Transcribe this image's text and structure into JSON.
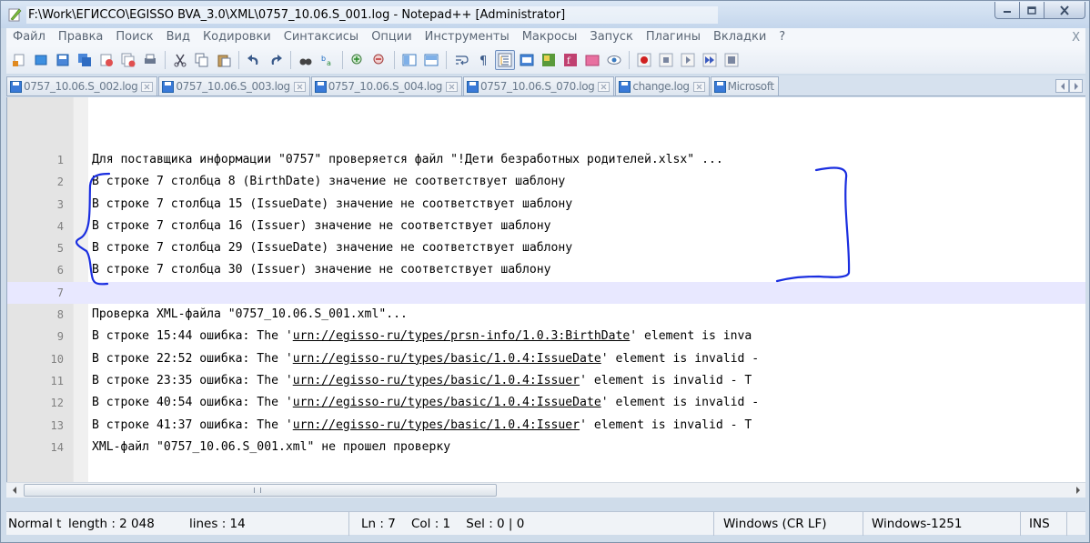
{
  "window": {
    "title": "F:\\Work\\ЕГИССО\\EGISSO BVA_3.0\\XML\\0757_10.06.S_001.log - Notepad++ [Administrator]"
  },
  "menu": {
    "items": [
      "Файл",
      "Правка",
      "Поиск",
      "Вид",
      "Кодировки",
      "Синтаксисы",
      "Опции",
      "Инструменты",
      "Макросы",
      "Запуск",
      "Плагины",
      "Вкладки",
      "?"
    ],
    "close": "X"
  },
  "tabs": [
    {
      "label": "0757_10.06.S_002.log"
    },
    {
      "label": "0757_10.06.S_003.log"
    },
    {
      "label": "0757_10.06.S_004.log"
    },
    {
      "label": "0757_10.06.S_070.log"
    },
    {
      "label": "change.log"
    },
    {
      "label": "Microsoft"
    }
  ],
  "editor": {
    "current_line": 7,
    "lines": [
      {
        "num": "1",
        "text": "Для поставщика информации \"0757\" проверяется файл \"!Дети безработных родителей.xlsx\" ..."
      },
      {
        "num": "2",
        "text": "В строке 7 столбца 8 (BirthDate) значение не соответствует шаблону"
      },
      {
        "num": "3",
        "text": "В строке 7 столбца 15 (IssueDate) значение не соответствует шаблону"
      },
      {
        "num": "4",
        "text": "В строке 7 столбца 16 (Issuer) значение не соответствует шаблону"
      },
      {
        "num": "5",
        "text": "В строке 7 столбца 29 (IssueDate) значение не соответствует шаблону"
      },
      {
        "num": "6",
        "text": "В строке 7 столбца 30 (Issuer) значение не соответствует шаблону"
      },
      {
        "num": "7",
        "text": ""
      },
      {
        "num": "8",
        "text": "Проверка XML-файла \"0757_10.06.S_001.xml\"..."
      },
      {
        "num": "9",
        "pre": "В строке 15:44 ошибка: The '",
        "url": "urn://egisso-ru/types/prsn-info/1.0.3:BirthDate",
        "post": "' element is inva"
      },
      {
        "num": "10",
        "pre": "В строке 22:52 ошибка: The '",
        "url": "urn://egisso-ru/types/basic/1.0.4:IssueDate",
        "post": "' element is invalid -"
      },
      {
        "num": "11",
        "pre": "В строке 23:35 ошибка: The '",
        "url": "urn://egisso-ru/types/basic/1.0.4:Issuer",
        "post": "' element is invalid - T"
      },
      {
        "num": "12",
        "pre": "В строке 40:54 ошибка: The '",
        "url": "urn://egisso-ru/types/basic/1.0.4:IssueDate",
        "post": "' element is invalid -"
      },
      {
        "num": "13",
        "pre": "В строке 41:37 ошибка: The '",
        "url": "urn://egisso-ru/types/basic/1.0.4:Issuer",
        "post": "' element is invalid - T"
      },
      {
        "num": "14",
        "text": "XML-файл \"0757_10.06.S_001.xml\" не прошел проверку"
      }
    ]
  },
  "status": {
    "mode": "Normal t",
    "length": "length : 2 048",
    "lines": "lines : 14",
    "position": "Ln : 7    Col : 1    Sel : 0 | 0",
    "eol": "Windows (CR LF)",
    "encoding": "Windows-1251",
    "ins": "INS"
  },
  "colors": {
    "annotation": "#1a2ee0",
    "current_line": "#e8e8ff"
  }
}
